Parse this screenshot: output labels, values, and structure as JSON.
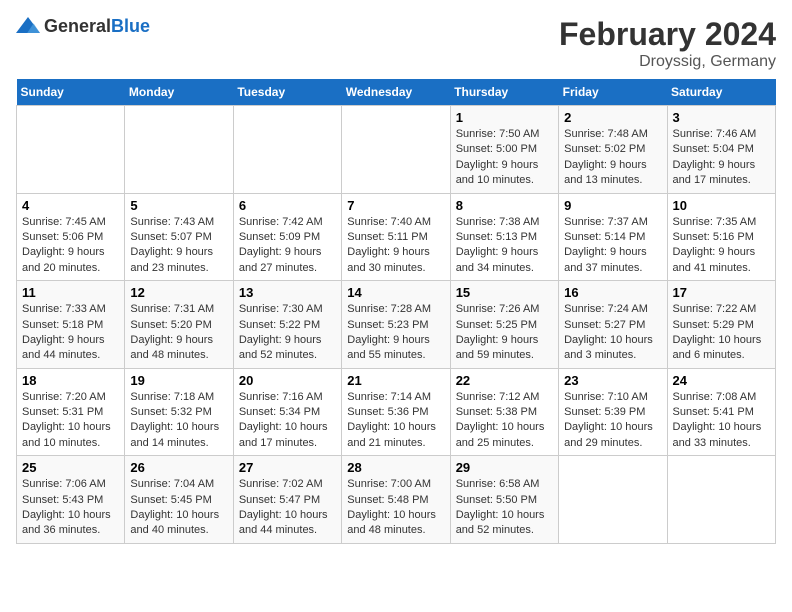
{
  "logo": {
    "text_general": "General",
    "text_blue": "Blue"
  },
  "title": "February 2024",
  "subtitle": "Droyssig, Germany",
  "days_of_week": [
    "Sunday",
    "Monday",
    "Tuesday",
    "Wednesday",
    "Thursday",
    "Friday",
    "Saturday"
  ],
  "weeks": [
    [
      {
        "day": "",
        "info": ""
      },
      {
        "day": "",
        "info": ""
      },
      {
        "day": "",
        "info": ""
      },
      {
        "day": "",
        "info": ""
      },
      {
        "day": "1",
        "info": "Sunrise: 7:50 AM\nSunset: 5:00 PM\nDaylight: 9 hours\nand 10 minutes."
      },
      {
        "day": "2",
        "info": "Sunrise: 7:48 AM\nSunset: 5:02 PM\nDaylight: 9 hours\nand 13 minutes."
      },
      {
        "day": "3",
        "info": "Sunrise: 7:46 AM\nSunset: 5:04 PM\nDaylight: 9 hours\nand 17 minutes."
      }
    ],
    [
      {
        "day": "4",
        "info": "Sunrise: 7:45 AM\nSunset: 5:06 PM\nDaylight: 9 hours\nand 20 minutes."
      },
      {
        "day": "5",
        "info": "Sunrise: 7:43 AM\nSunset: 5:07 PM\nDaylight: 9 hours\nand 23 minutes."
      },
      {
        "day": "6",
        "info": "Sunrise: 7:42 AM\nSunset: 5:09 PM\nDaylight: 9 hours\nand 27 minutes."
      },
      {
        "day": "7",
        "info": "Sunrise: 7:40 AM\nSunset: 5:11 PM\nDaylight: 9 hours\nand 30 minutes."
      },
      {
        "day": "8",
        "info": "Sunrise: 7:38 AM\nSunset: 5:13 PM\nDaylight: 9 hours\nand 34 minutes."
      },
      {
        "day": "9",
        "info": "Sunrise: 7:37 AM\nSunset: 5:14 PM\nDaylight: 9 hours\nand 37 minutes."
      },
      {
        "day": "10",
        "info": "Sunrise: 7:35 AM\nSunset: 5:16 PM\nDaylight: 9 hours\nand 41 minutes."
      }
    ],
    [
      {
        "day": "11",
        "info": "Sunrise: 7:33 AM\nSunset: 5:18 PM\nDaylight: 9 hours\nand 44 minutes."
      },
      {
        "day": "12",
        "info": "Sunrise: 7:31 AM\nSunset: 5:20 PM\nDaylight: 9 hours\nand 48 minutes."
      },
      {
        "day": "13",
        "info": "Sunrise: 7:30 AM\nSunset: 5:22 PM\nDaylight: 9 hours\nand 52 minutes."
      },
      {
        "day": "14",
        "info": "Sunrise: 7:28 AM\nSunset: 5:23 PM\nDaylight: 9 hours\nand 55 minutes."
      },
      {
        "day": "15",
        "info": "Sunrise: 7:26 AM\nSunset: 5:25 PM\nDaylight: 9 hours\nand 59 minutes."
      },
      {
        "day": "16",
        "info": "Sunrise: 7:24 AM\nSunset: 5:27 PM\nDaylight: 10 hours\nand 3 minutes."
      },
      {
        "day": "17",
        "info": "Sunrise: 7:22 AM\nSunset: 5:29 PM\nDaylight: 10 hours\nand 6 minutes."
      }
    ],
    [
      {
        "day": "18",
        "info": "Sunrise: 7:20 AM\nSunset: 5:31 PM\nDaylight: 10 hours\nand 10 minutes."
      },
      {
        "day": "19",
        "info": "Sunrise: 7:18 AM\nSunset: 5:32 PM\nDaylight: 10 hours\nand 14 minutes."
      },
      {
        "day": "20",
        "info": "Sunrise: 7:16 AM\nSunset: 5:34 PM\nDaylight: 10 hours\nand 17 minutes."
      },
      {
        "day": "21",
        "info": "Sunrise: 7:14 AM\nSunset: 5:36 PM\nDaylight: 10 hours\nand 21 minutes."
      },
      {
        "day": "22",
        "info": "Sunrise: 7:12 AM\nSunset: 5:38 PM\nDaylight: 10 hours\nand 25 minutes."
      },
      {
        "day": "23",
        "info": "Sunrise: 7:10 AM\nSunset: 5:39 PM\nDaylight: 10 hours\nand 29 minutes."
      },
      {
        "day": "24",
        "info": "Sunrise: 7:08 AM\nSunset: 5:41 PM\nDaylight: 10 hours\nand 33 minutes."
      }
    ],
    [
      {
        "day": "25",
        "info": "Sunrise: 7:06 AM\nSunset: 5:43 PM\nDaylight: 10 hours\nand 36 minutes."
      },
      {
        "day": "26",
        "info": "Sunrise: 7:04 AM\nSunset: 5:45 PM\nDaylight: 10 hours\nand 40 minutes."
      },
      {
        "day": "27",
        "info": "Sunrise: 7:02 AM\nSunset: 5:47 PM\nDaylight: 10 hours\nand 44 minutes."
      },
      {
        "day": "28",
        "info": "Sunrise: 7:00 AM\nSunset: 5:48 PM\nDaylight: 10 hours\nand 48 minutes."
      },
      {
        "day": "29",
        "info": "Sunrise: 6:58 AM\nSunset: 5:50 PM\nDaylight: 10 hours\nand 52 minutes."
      },
      {
        "day": "",
        "info": ""
      },
      {
        "day": "",
        "info": ""
      }
    ]
  ]
}
